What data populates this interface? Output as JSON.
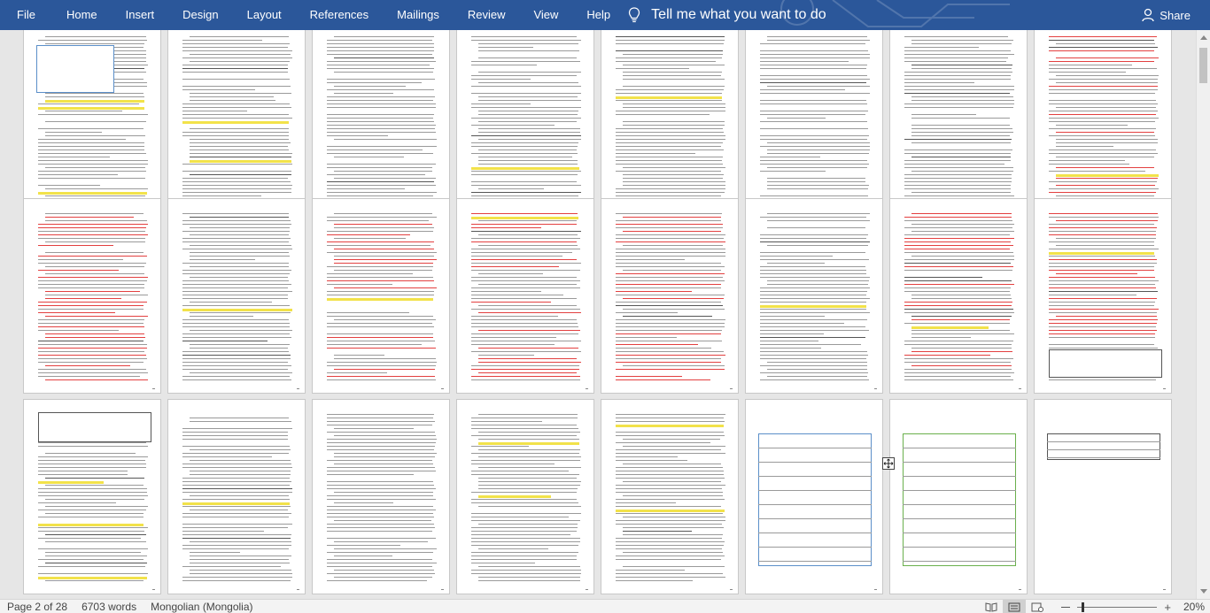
{
  "menu": {
    "items": [
      "File",
      "Home",
      "Insert",
      "Design",
      "Layout",
      "References",
      "Mailings",
      "Review",
      "View",
      "Help"
    ],
    "tell_me": "Tell me what you want to do",
    "share": "Share"
  },
  "status": {
    "page": "Page 2 of 28",
    "words": "6703 words",
    "language": "Mongolian (Mongolia)",
    "zoom": "20%",
    "zoom_level_percent": 20
  },
  "document": {
    "visible_page_count": 24
  },
  "colors": {
    "ribbon": "#2b579a",
    "canvas": "#e6e6e6",
    "red_text": "#e34040",
    "highlight": "#f2e24a"
  }
}
